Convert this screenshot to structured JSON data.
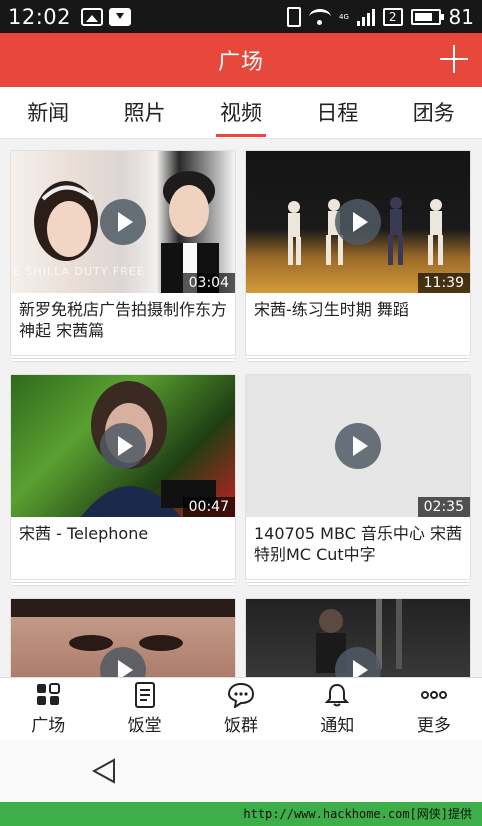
{
  "status_bar": {
    "time": "12:02",
    "battery": "81",
    "sim": "2",
    "network": "4G"
  },
  "header": {
    "title": "广场"
  },
  "tabs": [
    {
      "label": "新闻"
    },
    {
      "label": "照片"
    },
    {
      "label": "视频",
      "active": true
    },
    {
      "label": "日程"
    },
    {
      "label": "团务"
    }
  ],
  "videos": [
    {
      "title": "新罗免税店广告拍摄制作东方神起 宋茜篇",
      "duration": "03:04"
    },
    {
      "title": "宋茜-练习生时期 舞蹈",
      "duration": "11:39"
    },
    {
      "title": "宋茜 - Telephone",
      "duration": "00:47"
    },
    {
      "title": "140705 MBC 音乐中心 宋茜特别MC Cut中字",
      "duration": "02:35"
    },
    {
      "title": "",
      "duration": ""
    },
    {
      "title": "",
      "duration": ""
    }
  ],
  "thumbnail_overlay_text": "E SHILLA DUTY FREE",
  "bottom_nav": [
    {
      "label": "广场",
      "icon": "grid-icon"
    },
    {
      "label": "饭堂",
      "icon": "document-icon"
    },
    {
      "label": "饭群",
      "icon": "chat-icon"
    },
    {
      "label": "通知",
      "icon": "bell-icon"
    },
    {
      "label": "更多",
      "icon": "more-icon"
    }
  ],
  "watermark": "http://www.hackhome.com[网侠]提供",
  "colors": {
    "accent": "#e8473c",
    "status_bar": "#171717",
    "watermark_bg": "#3dae48"
  }
}
